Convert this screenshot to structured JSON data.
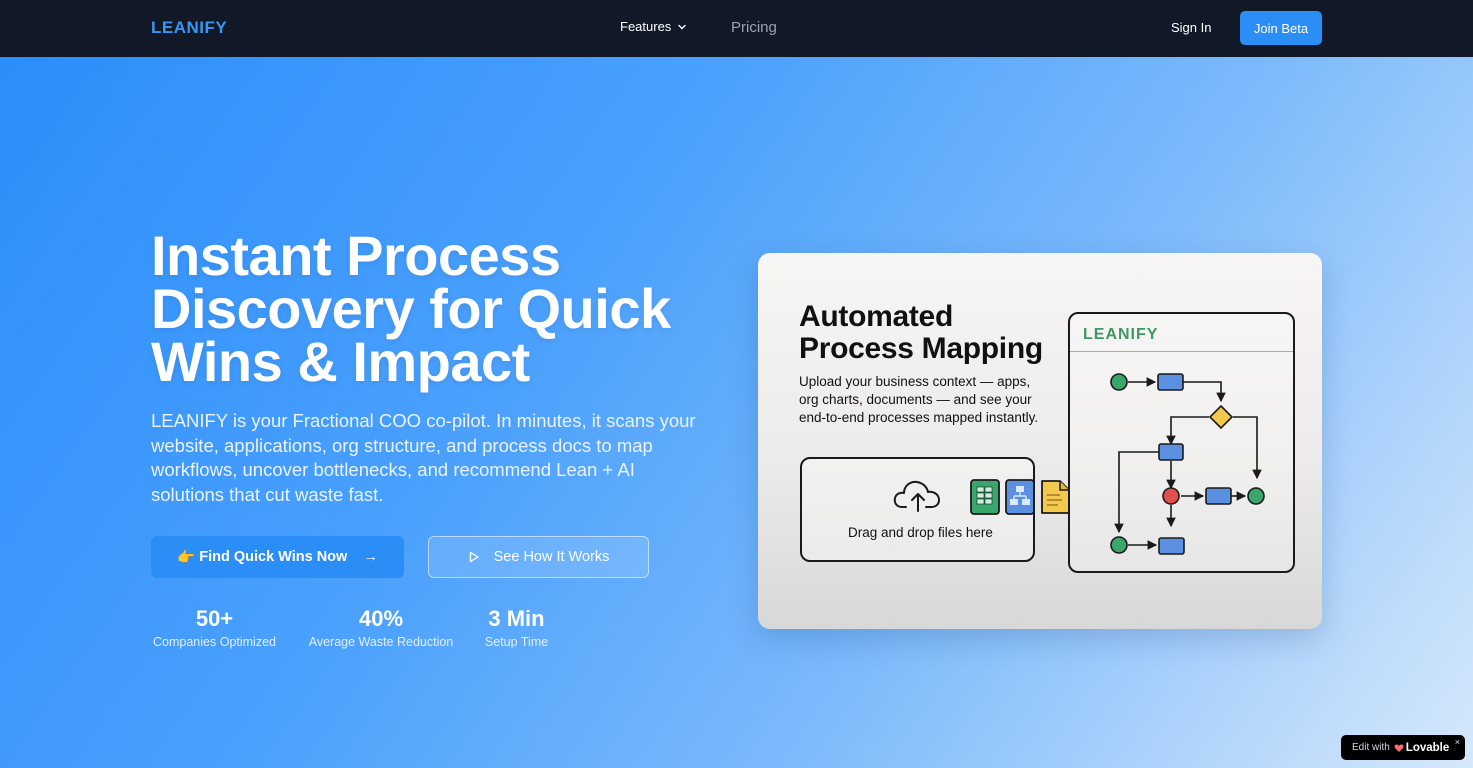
{
  "nav": {
    "logo": "LEANIFY",
    "features_label": "Features",
    "pricing_label": "Pricing",
    "signin_label": "Sign In",
    "join_label": "Join Beta"
  },
  "hero": {
    "title": "Instant Process Discovery for Quick Wins & Impact",
    "description": "LEANIFY is your Fractional COO co-pilot. In minutes, it scans your website, applications, org structure, and process docs to map workflows, uncover bottlenecks, and recommend Lean + AI solutions that cut waste fast.",
    "primary_cta_emoji": "👉",
    "primary_cta": "Find Quick Wins Now",
    "primary_cta_arrow": "→",
    "secondary_cta": "See How It Works"
  },
  "stats": [
    {
      "value": "50+",
      "label": "Companies Optimized"
    },
    {
      "value": "40%",
      "label": "Average Waste Reduction"
    },
    {
      "value": "3 Min",
      "label": "Setup Time"
    }
  ],
  "card": {
    "title": "Automated Process Mapping",
    "description": "Upload your business context — apps, org charts, documents — and see your end-to-end processes mapped instantly.",
    "drop_text": "Drag and drop files here",
    "panel_logo": "LEANIFY"
  },
  "badge": {
    "prefix": "Edit with",
    "brand": "Lovable",
    "close": "×"
  },
  "colors": {
    "nav_bg": "#111827",
    "accent": "#2b8df6",
    "logo": "#3b96f3",
    "panel_logo": "#3b9a66",
    "node_green": "#3aa66b",
    "node_blue": "#5b8fe0",
    "node_red": "#e0504d",
    "node_yellow": "#f2c94c"
  }
}
